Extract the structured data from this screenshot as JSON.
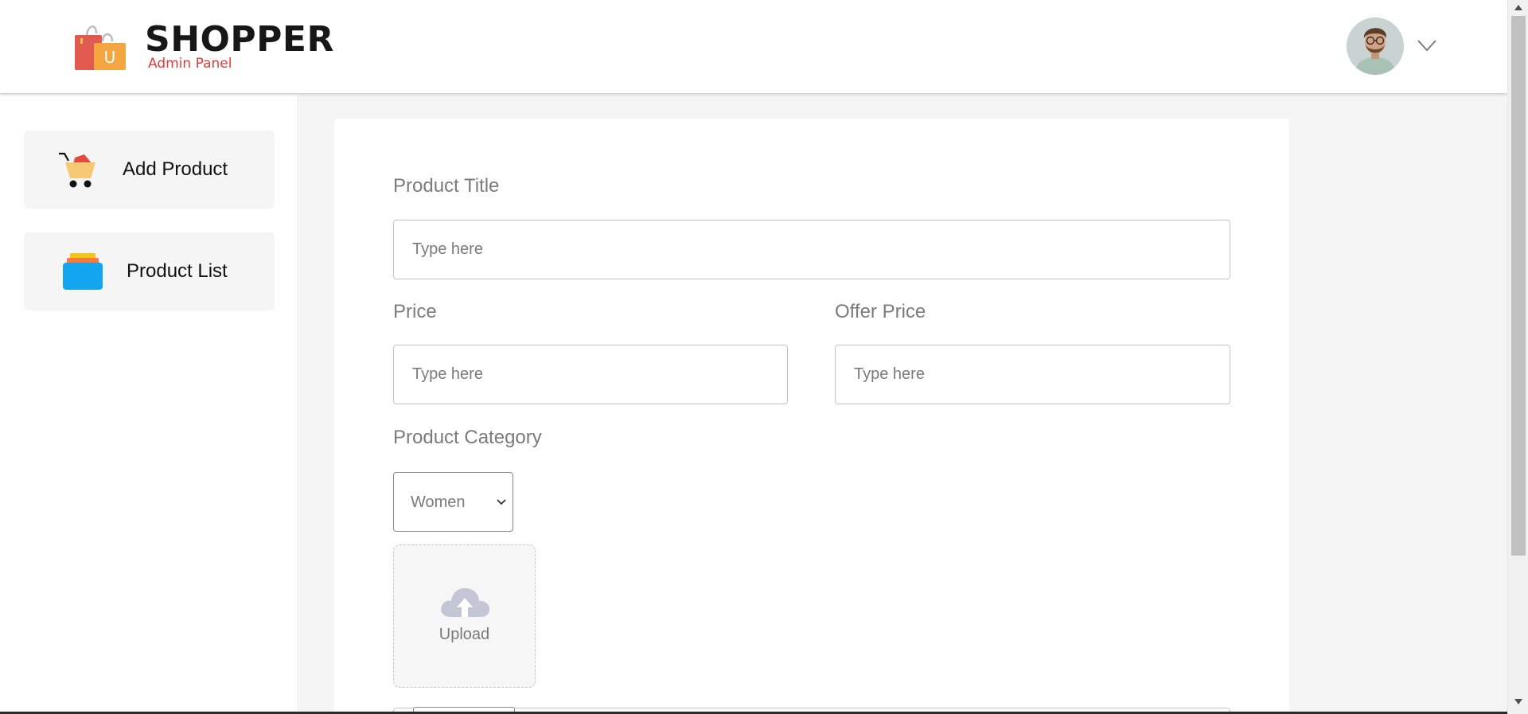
{
  "header": {
    "brand_name": "SHOPPER",
    "brand_subtitle": "Admin Panel",
    "logo_icon": "shopping-bag-icon",
    "logo_letter": "U",
    "avatar_icon": "user-avatar",
    "dropdown_icon": "chevron-down-icon"
  },
  "sidebar": {
    "items": [
      {
        "label": "Add Product",
        "icon": "cart-icon"
      },
      {
        "label": "Product List",
        "icon": "stack-icon"
      }
    ]
  },
  "form": {
    "title_label": "Product Title",
    "title_placeholder": "Type here",
    "price_label": "Price",
    "price_placeholder": "Type here",
    "offer_price_label": "Offer Price",
    "offer_price_placeholder": "Type here",
    "category_label": "Product Category",
    "category_selected": "Women",
    "upload_label": "Upload",
    "upload_icon": "cloud-upload-icon"
  },
  "colors": {
    "brand_red": "#e23b3b",
    "main_bg": "#f5f5f5",
    "sidebar_item_bg": "#f5f5f5",
    "label_gray": "#7b7b7b"
  }
}
